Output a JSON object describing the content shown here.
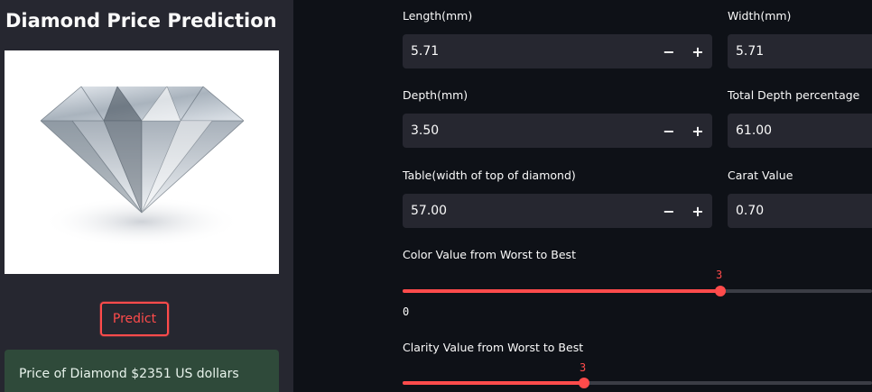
{
  "sidebar": {
    "title": "Diamond Price Prediction",
    "image": "diamond",
    "predict_label": "Predict",
    "result_text": "Price of Diamond $2351 US dollars"
  },
  "inputs": {
    "length": {
      "label": "Length(mm)",
      "value": "5.71"
    },
    "width": {
      "label": "Width(mm)",
      "value": "5.71"
    },
    "depth": {
      "label": "Depth(mm)",
      "value": "3.50"
    },
    "total_depth": {
      "label": "Total Depth percentage",
      "value": "61.00"
    },
    "table": {
      "label": "Table(width of top of diamond)",
      "value": "57.00"
    },
    "carat": {
      "label": "Carat Value",
      "value": "0.70"
    },
    "minus": "−",
    "plus": "+"
  },
  "sliders": {
    "color": {
      "label": "Color Value from Worst to Best",
      "value": "3",
      "min": "0"
    },
    "clarity": {
      "label": "Clarity Value from Worst to Best",
      "value": "3"
    }
  },
  "colors": {
    "accent": "#ff4b4b",
    "background": "#0e1117",
    "sidebar": "#262730",
    "success": "#2f4a3a"
  }
}
